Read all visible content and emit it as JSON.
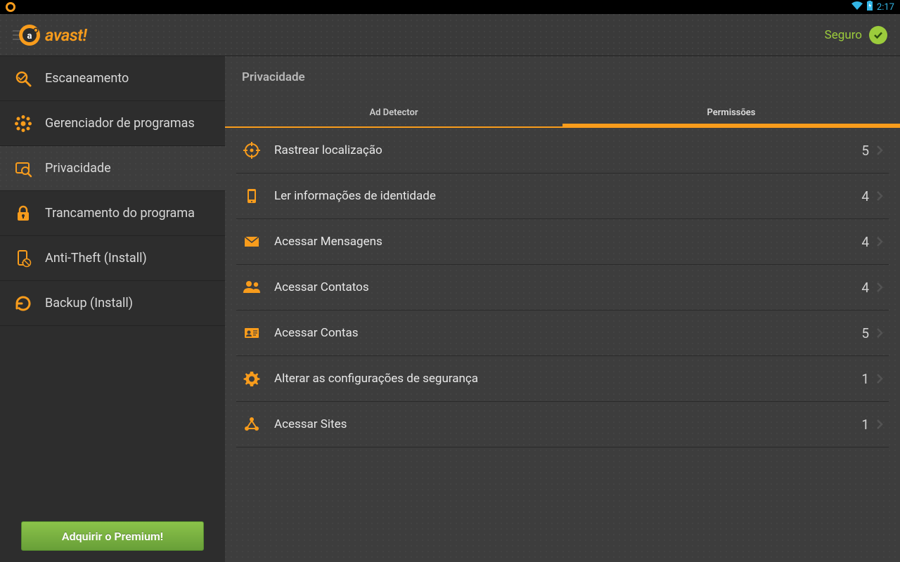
{
  "status_bar": {
    "time": "2:17"
  },
  "header": {
    "app_name": "avast!",
    "safe_label": "Seguro"
  },
  "sidebar": {
    "items": [
      {
        "label": "Escaneamento",
        "icon": "scan-icon"
      },
      {
        "label": "Gerenciador de programas",
        "icon": "apps-icon"
      },
      {
        "label": "Privacidade",
        "icon": "privacy-icon",
        "active": true
      },
      {
        "label": "Trancamento do programa",
        "icon": "lock-icon"
      },
      {
        "label": "Anti-Theft (Install)",
        "icon": "anti-theft-icon"
      },
      {
        "label": "Backup (Install)",
        "icon": "backup-icon"
      }
    ],
    "premium_button": "Adquirir o Premium!"
  },
  "content": {
    "title": "Privacidade",
    "tabs": [
      {
        "label": "Ad Detector"
      },
      {
        "label": "Permissões",
        "active": true
      }
    ],
    "permissions": [
      {
        "label": "Rastrear localização",
        "count": "5"
      },
      {
        "label": "Ler informações de identidade",
        "count": "4"
      },
      {
        "label": "Acessar Mensagens",
        "count": "4"
      },
      {
        "label": "Acessar Contatos",
        "count": "4"
      },
      {
        "label": "Acessar Contas",
        "count": "5"
      },
      {
        "label": "Alterar as configurações de segurança",
        "count": "1"
      },
      {
        "label": "Acessar Sites",
        "count": "1"
      }
    ]
  }
}
